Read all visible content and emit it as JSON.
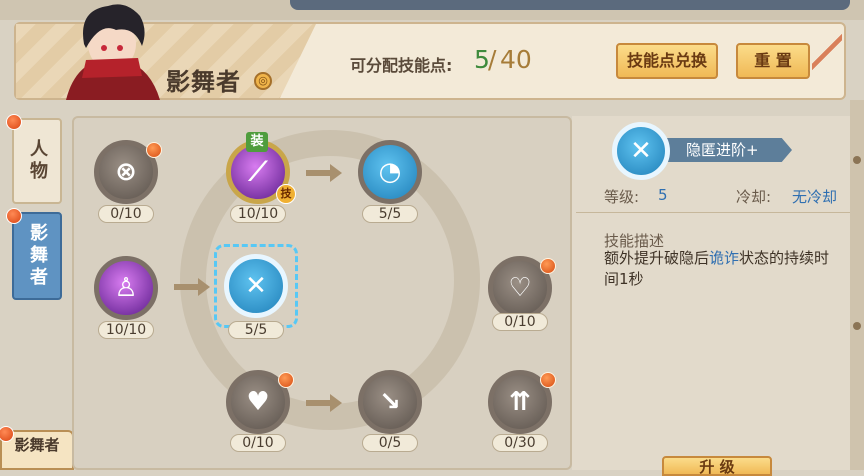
{
  "header": {
    "character_name": "影舞者",
    "points_label": "可分配技能点:",
    "points_current": "5",
    "points_sep": "/",
    "points_max": "40",
    "exchange_label": "技能点兑换",
    "reset_label": "重 置"
  },
  "tabs": {
    "character": "人物",
    "skills": "影舞者",
    "bottom": "影舞者"
  },
  "skills": {
    "s1": {
      "level": "0/10",
      "icon": "target-icon"
    },
    "s2": {
      "level": "10/10",
      "icon": "slash-icon",
      "equip": "装",
      "tag": "技"
    },
    "s3": {
      "level": "5/5",
      "icon": "gauge-icon"
    },
    "s4": {
      "level": "10/10",
      "icon": "shadow-icon"
    },
    "s5": {
      "level": "5/5",
      "icon": "stealth-icon"
    },
    "s6": {
      "level": "0/10",
      "icon": "heart-plus-icon"
    },
    "s7": {
      "level": "0/10",
      "icon": "heart-icon"
    },
    "s8": {
      "level": "0/5",
      "icon": "arrow-down-right-icon"
    },
    "s9": {
      "level": "0/30",
      "icon": "arrows-up-icon"
    }
  },
  "detail": {
    "name": "隐匿进阶+",
    "level_label": "等级:",
    "level_value": "5",
    "cooldown_label": "冷却:",
    "cooldown_value": "无冷却",
    "desc_title": "技能描述",
    "desc_prefix": "额外提升破隐后",
    "desc_keyword": "诡诈",
    "desc_suffix": "状态的持续时间1秒",
    "upgrade_label": "升 级"
  },
  "colors": {
    "accent_green": "#3e8a3c",
    "accent_blue": "#2f6fb1",
    "button_gold": "#f0b956",
    "tab_active": "#5f93c2"
  }
}
